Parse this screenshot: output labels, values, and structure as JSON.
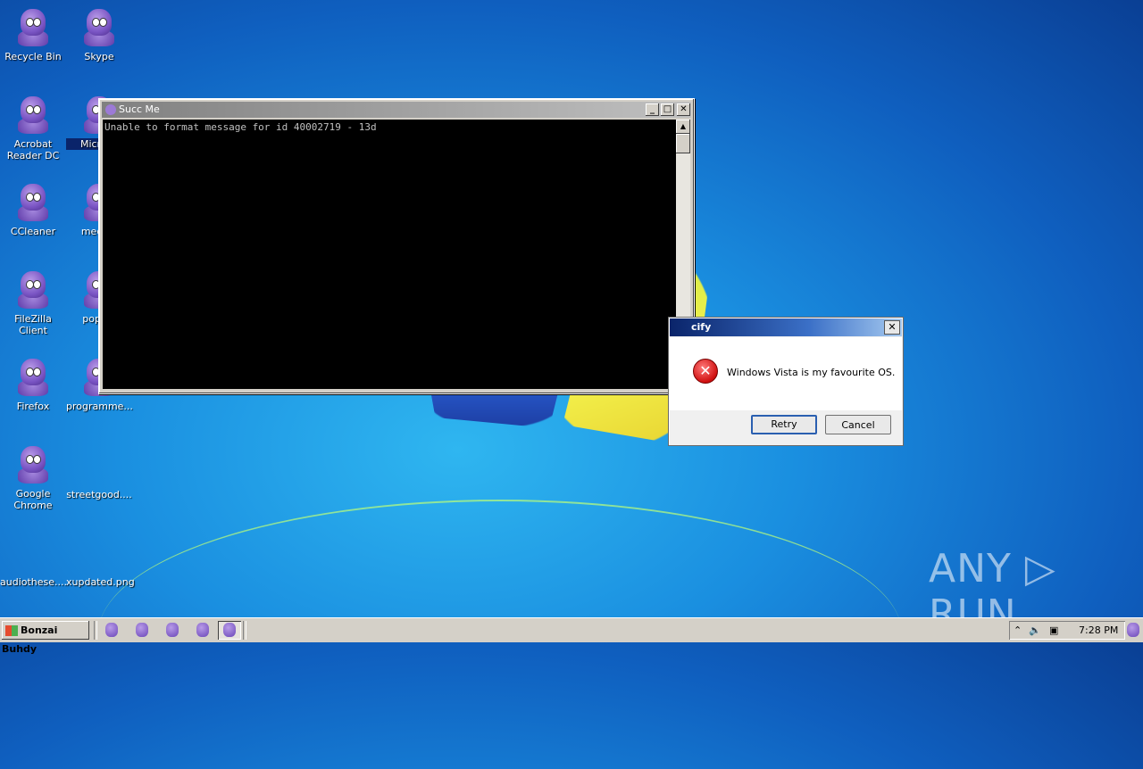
{
  "desktop": {
    "icons": [
      {
        "label": "Recycle Bin"
      },
      {
        "label": "Skype"
      },
      {
        "label": "Acrobat Reader DC"
      },
      {
        "label": "Microso"
      },
      {
        "label": "CCleaner"
      },
      {
        "label": "medica"
      },
      {
        "label": "FileZilla Client"
      },
      {
        "label": "popula"
      },
      {
        "label": "Firefox"
      },
      {
        "label": "programme..."
      },
      {
        "label": "Google Chrome"
      },
      {
        "label": "streetgood...."
      },
      {
        "label": "audiothese...."
      },
      {
        "label": "xupdated.png"
      }
    ]
  },
  "console": {
    "title": "Succ Me",
    "output": "Unable to format message for id 40002719 - 13d",
    "min_label": "_",
    "max_label": "□",
    "close_label": "✕"
  },
  "msgbox": {
    "title": "cify",
    "message": "Windows Vista is my favourite OS.",
    "retry_label": "Retry",
    "cancel_label": "Cancel",
    "close_label": "✕"
  },
  "watermark": {
    "text": "ANY ▷ RUN"
  },
  "taskbar": {
    "start_label": "Bonzai Buhdy",
    "clock": "7:28 PM"
  }
}
